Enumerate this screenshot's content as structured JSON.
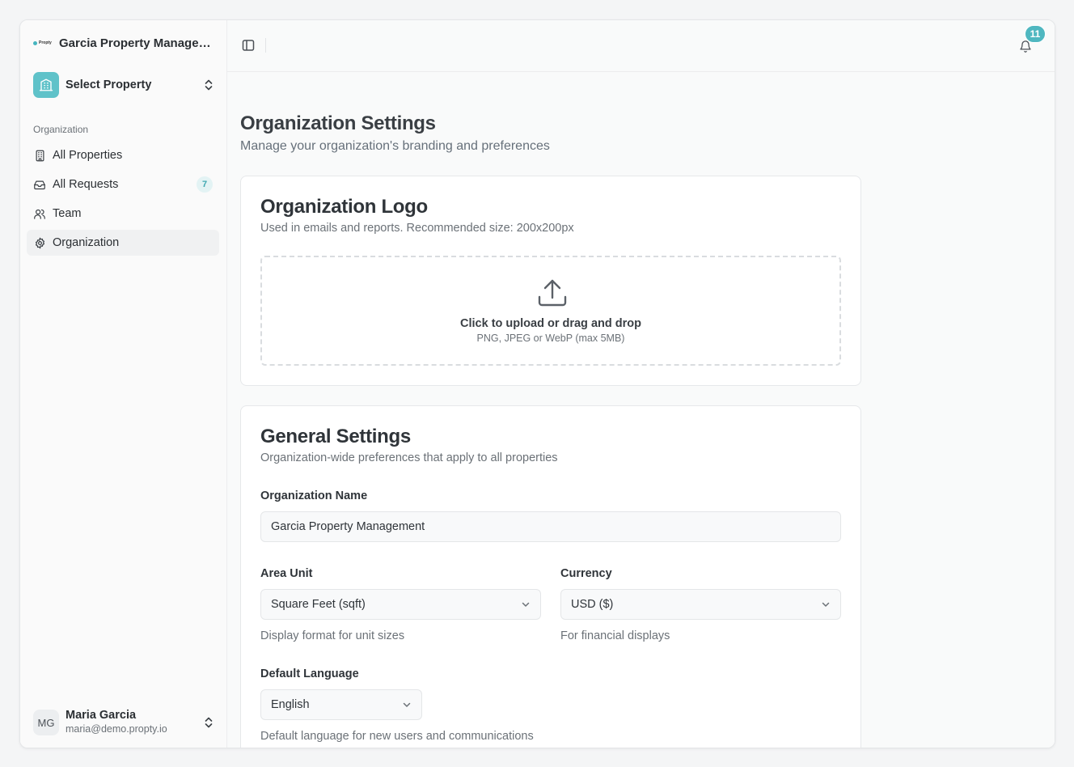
{
  "sidebar": {
    "org_name": "Garcia Property Managem...",
    "logo_text": "Propty",
    "property_selector": "Select Property",
    "section_label": "Organization",
    "items": [
      {
        "label": "All Properties"
      },
      {
        "label": "All Requests",
        "badge": "7"
      },
      {
        "label": "Team"
      },
      {
        "label": "Organization"
      }
    ],
    "user": {
      "initials": "MG",
      "name": "Maria Garcia",
      "email": "maria@demo.propty.io"
    }
  },
  "topbar": {
    "notification_count": "11"
  },
  "page": {
    "title": "Organization Settings",
    "subtitle": "Manage your organization's branding and preferences"
  },
  "logo_card": {
    "title": "Organization Logo",
    "subtitle": "Used in emails and reports. Recommended size: 200x200px",
    "upload_text": "Click to upload or drag and drop",
    "upload_hint": "PNG, JPEG or WebP (max 5MB)"
  },
  "general_card": {
    "title": "General Settings",
    "subtitle": "Organization-wide preferences that apply to all properties",
    "org_name_label": "Organization Name",
    "org_name_value": "Garcia Property Management",
    "area_unit_label": "Area Unit",
    "area_unit_value": "Square Feet (sqft)",
    "area_unit_helper": "Display format for unit sizes",
    "currency_label": "Currency",
    "currency_value": "USD ($)",
    "currency_helper": "For financial displays",
    "language_label": "Default Language",
    "language_value": "English",
    "language_helper": "Default language for new users and communications"
  },
  "colors": {
    "accent": "#4fb7c0",
    "property_icon_bg": "#5fc2c9"
  }
}
